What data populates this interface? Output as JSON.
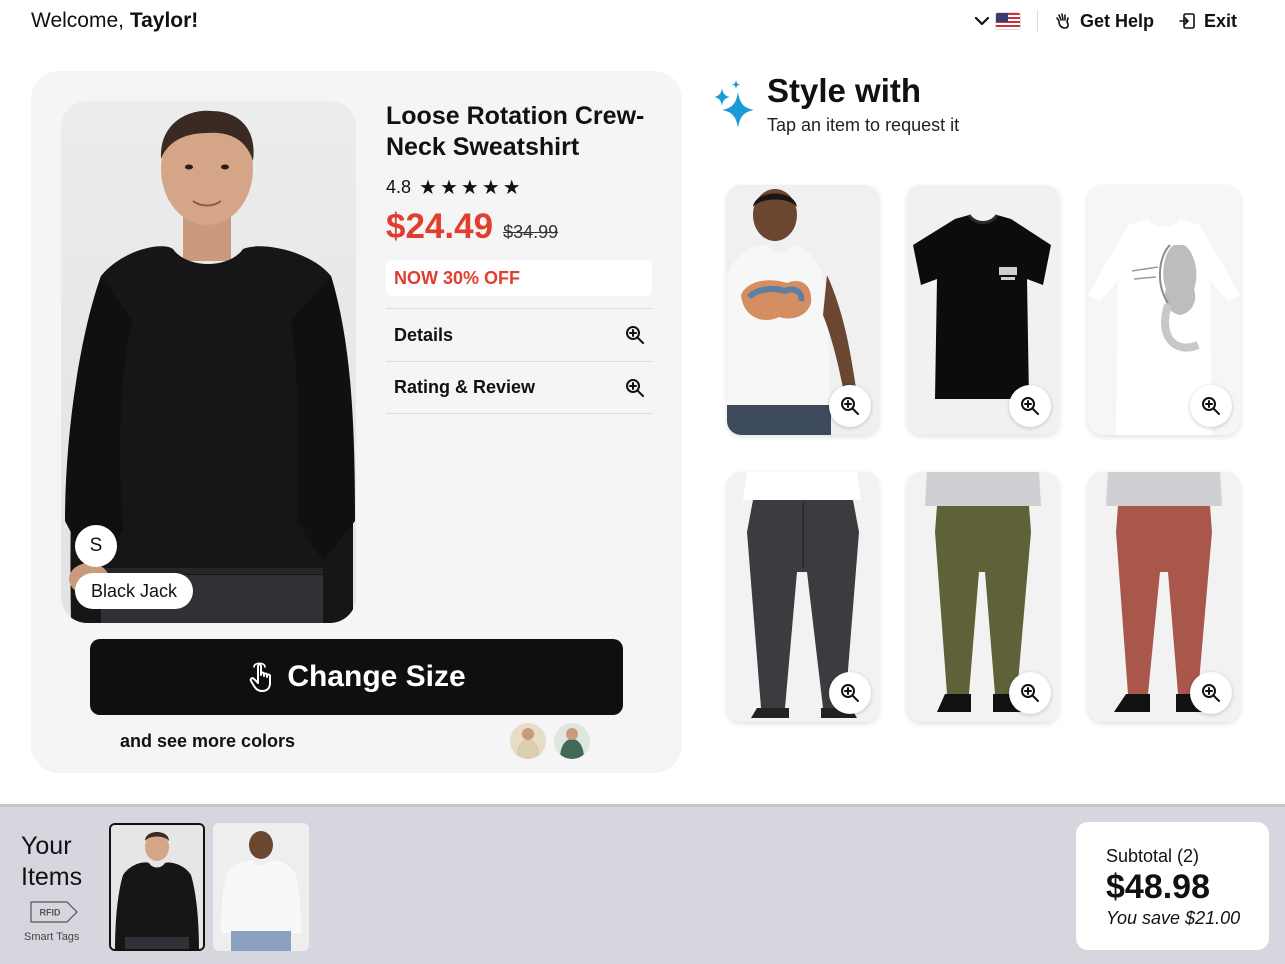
{
  "header": {
    "welcome_prefix": "Welcome, ",
    "user_name": "Taylor!",
    "get_help": "Get Help",
    "exit": "Exit",
    "language_flag": "us-flag-icon"
  },
  "product": {
    "title": "Loose Rotation Crew-Neck Sweatshirt",
    "rating": "4.8",
    "stars": "★★★★★",
    "rating_value": 4.8,
    "price": "$24.49",
    "original_price": "$34.99",
    "discount": "NOW 30% OFF",
    "size": "S",
    "color": "Black Jack",
    "details_label": "Details",
    "reviews_label": "Rating & Review",
    "change_size_label": "Change Size",
    "more_colors_label": "and see more colors",
    "swatches": [
      "#e8dcc7",
      "#3f6a55"
    ]
  },
  "style_with": {
    "title": "Style with",
    "subtitle": "Tap an item to request it",
    "items": [
      {
        "name": "white-graphic-tee-bear"
      },
      {
        "name": "black-graphic-tee"
      },
      {
        "name": "white-graphic-tee-portrait"
      },
      {
        "name": "black-jeans"
      },
      {
        "name": "olive-pants"
      },
      {
        "name": "rust-pants"
      }
    ]
  },
  "bottom": {
    "your_items": "Your Items",
    "rfid_label": "RFID",
    "smart_tags": "Smart Tags",
    "subtotal_label": "Subtotal (2)",
    "subtotal_value": "$48.98",
    "savings": "You save $21.00"
  },
  "colors": {
    "accent_red": "#e03e2f",
    "button_black": "#0f0f0f",
    "bar_gray": "#d6d7de"
  }
}
